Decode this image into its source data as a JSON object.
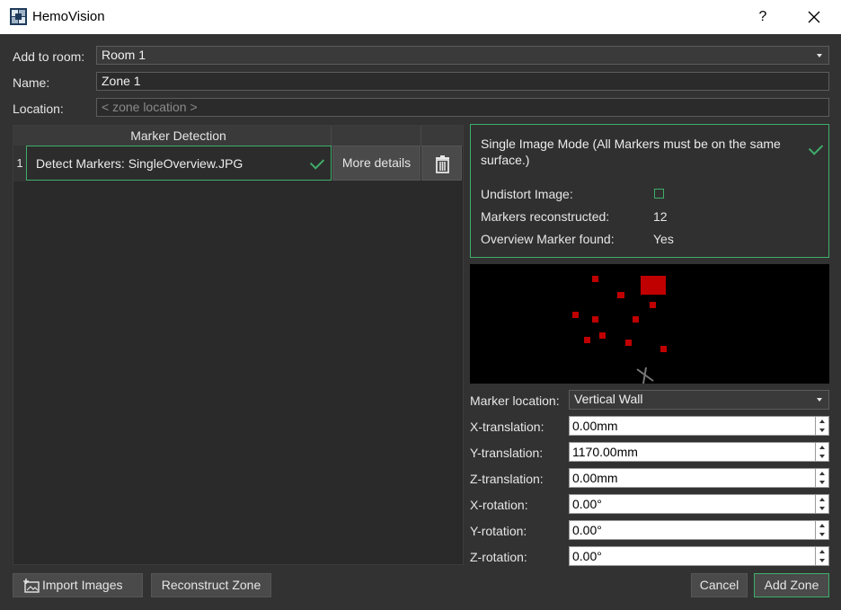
{
  "window": {
    "title": "HemoVision",
    "help_label": "?"
  },
  "form": {
    "room_label": "Add to room:",
    "room_value": "Room 1",
    "name_label": "Name:",
    "name_value": "Zone 1",
    "location_label": "Location:",
    "location_placeholder": "< zone location >"
  },
  "table": {
    "header": "Marker Detection",
    "rows": [
      {
        "num": "1",
        "text": "Detect Markers: SingleOverview.JPG",
        "details_label": "More details"
      }
    ]
  },
  "info": {
    "mode_text": "Single Image Mode (All Markers must be on the same surface.)",
    "undistort_label": "Undistort Image:",
    "undistort_checked": false,
    "reconstructed_label": "Markers reconstructed:",
    "reconstructed_value": "12",
    "overview_label": "Overview Marker found:",
    "overview_value": "Yes"
  },
  "preview": {
    "marker_color": "#c00000",
    "markers_count": 12
  },
  "params": {
    "marker_location_label": "Marker location:",
    "marker_location_value": "Vertical Wall",
    "fields": [
      {
        "label": "X-translation:",
        "value": "0.00mm"
      },
      {
        "label": "Y-translation:",
        "value": "1170.00mm"
      },
      {
        "label": "Z-translation:",
        "value": "0.00mm"
      },
      {
        "label": "X-rotation:",
        "value": "0.00°"
      },
      {
        "label": "Y-rotation:",
        "value": "0.00°"
      },
      {
        "label": "Z-rotation:",
        "value": "0.00°"
      }
    ]
  },
  "footer": {
    "import_label": "Import Images",
    "reconstruct_label": "Reconstruct Zone",
    "cancel_label": "Cancel",
    "add_label": "Add Zone"
  },
  "colors": {
    "accent": "#3fae6a",
    "background": "#323232"
  },
  "icons": [
    "app-icon",
    "close-icon",
    "checkmark-icon",
    "trash-icon",
    "import-images-icon",
    "chevron-down-icon"
  ]
}
